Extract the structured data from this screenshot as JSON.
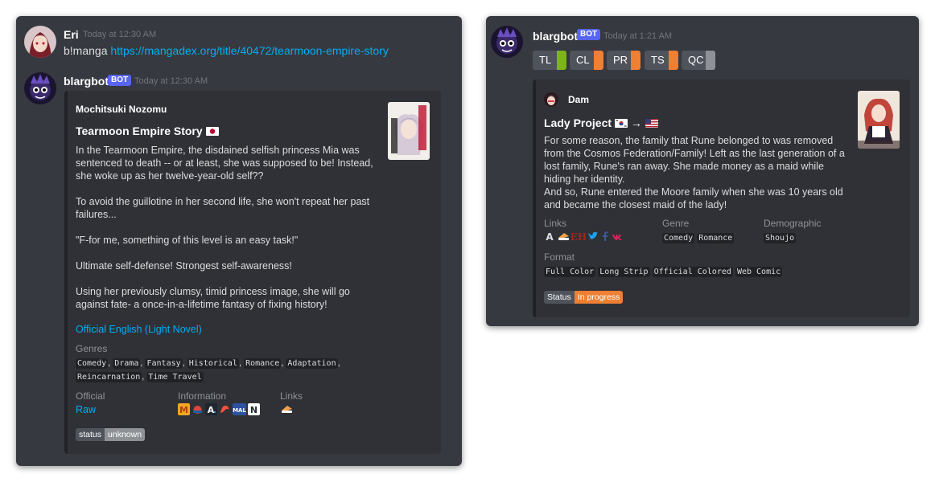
{
  "left": {
    "user_message": {
      "author": "Eri",
      "timestamp": "Today at 12:30 AM",
      "command": "b!manga",
      "url": "https://mangadex.org/title/40472/tearmoon-empire-story"
    },
    "bot_message": {
      "author": "blargbot",
      "badge": "BOT",
      "timestamp": "Today at 12:30 AM",
      "embed": {
        "author": "Mochitsuki Nozomu",
        "title": "Tearmoon Empire Story",
        "flag": "japan-flag",
        "description": [
          "In the Tearmoon Empire, the disdained selfish princess Mia was sentenced to death -- or at least, she was supposed to be! Instead, she woke up as her twelve-year-old self??",
          "To avoid the guillotine in her second life, she won't repeat her past failures...",
          "\"F-for me, something of this level is an easy task!\"",
          "Ultimate self-defense! Strongest self-awareness!",
          "Using her previously clumsy, timid princess image, she will go against fate- a once-in-a-lifetime fantasy of fixing history!"
        ],
        "official_link": "Official English (Light Novel)",
        "genres_label": "Genres",
        "genres": [
          "Comedy",
          "Drama",
          "Fantasy",
          "Historical",
          "Romance",
          "Adaptation",
          "Reincarnation",
          "Time Travel"
        ],
        "official_label": "Official",
        "official_value": "Raw",
        "information_label": "Information",
        "information_icons": [
          "mangaupdates-icon",
          "novelupdates-icon",
          "anilist-icon",
          "kitsu-icon",
          "myanimelist-icon",
          "nu-icon"
        ],
        "links_label": "Links",
        "links_icons": [
          "raw-link-icon"
        ],
        "status_label": "status",
        "status_value": "unknown"
      }
    }
  },
  "right": {
    "bot_message": {
      "author": "blargbot",
      "badge": "BOT",
      "timestamp": "Today at 1:21 AM",
      "chips": [
        {
          "label": "TL",
          "color": "#7cb518"
        },
        {
          "label": "CL",
          "color": "#ee7f33"
        },
        {
          "label": "PR",
          "color": "#ee7f33"
        },
        {
          "label": "TS",
          "color": "#ee7f33"
        },
        {
          "label": "QC",
          "color": "#8e9297"
        }
      ],
      "embed": {
        "author": "Dam",
        "title": "Lady Project",
        "title_arrow": "→",
        "flag_from": "south-korea-flag",
        "flag_to": "usa-flag",
        "description": [
          "For some reason, the family that Rune belonged to was removed from the Cosmos Federation/Family! Left as the last generation of a lost family, Rune's ran away. She made money as a maid while hiding her identity.",
          "And so, Rune entered the Moore family when she was 10 years old and became the closest maid of the lady!"
        ],
        "links_label": "Links",
        "links_icons": [
          "anilist-icon",
          "kitsu-icon",
          "eh-icon",
          "twitter-icon",
          "facebook-icon",
          "vk-icon"
        ],
        "genre_label": "Genre",
        "genres": [
          "Comedy",
          "Romance"
        ],
        "demographic_label": "Demographic",
        "demographic": "Shoujo",
        "format_label": "Format",
        "formats": [
          "Full Color",
          "Long Strip",
          "Official Colored",
          "Web Comic"
        ],
        "status_label": "Status",
        "status_value": "In progress",
        "status_color": "#ee7f33"
      }
    }
  }
}
